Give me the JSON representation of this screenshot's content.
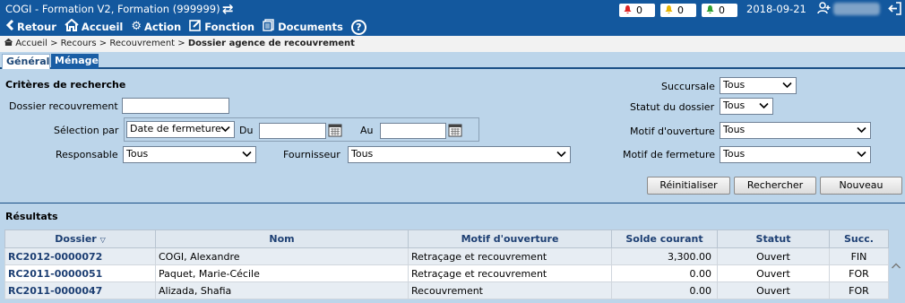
{
  "app": {
    "title": "COGI - Formation V2, Formation (999999)"
  },
  "toolbar": {
    "back_label": "Retour",
    "home_label": "Accueil",
    "action_label": "Action",
    "function_label": "Fonction",
    "documents_label": "Documents"
  },
  "alerts": {
    "red": "0",
    "yellow": "0",
    "green": "0"
  },
  "date": "2018-09-21",
  "breadcrumb": {
    "home": "Accueil",
    "recours": "Recours",
    "recouvrement": "Recouvrement",
    "current": "Dossier agence de recouvrement",
    "sep": ">"
  },
  "tabs": {
    "general": "Général",
    "menage": "Ménage"
  },
  "criteria": {
    "title": "Critères de recherche",
    "dossier_label": "Dossier recouvrement",
    "dossier_value": "",
    "selection_label": "Sélection par",
    "selection_value": "Date de fermeture",
    "du_label": "Du",
    "du_value": "",
    "au_label": "Au",
    "au_value": "",
    "responsable_label": "Responsable",
    "responsable_value": "Tous",
    "fournisseur_label": "Fournisseur",
    "fournisseur_value": "Tous",
    "succursale_label": "Succursale",
    "succursale_value": "Tous",
    "statut_label": "Statut du dossier",
    "statut_value": "Tous",
    "motif_ouv_label": "Motif d'ouverture",
    "motif_ouv_value": "Tous",
    "motif_ferm_label": "Motif de fermeture",
    "motif_ferm_value": "Tous"
  },
  "buttons": {
    "reset": "Réinitialiser",
    "search": "Rechercher",
    "new": "Nouveau"
  },
  "results": {
    "title": "Résultats",
    "columns": [
      "Dossier",
      "Nom",
      "Motif d'ouverture",
      "Solde courant",
      "Statut",
      "Succ."
    ],
    "rows": [
      [
        "RC2012-0000072",
        "COGI, Alexandre",
        "Retraçage et recouvrement",
        "3,300.00",
        "Ouvert",
        "FIN"
      ],
      [
        "RC2011-0000051",
        "Paquet, Marie-Cécile",
        "Retraçage et recouvrement",
        "0.00",
        "Ouvert",
        "FOR"
      ],
      [
        "RC2011-0000047",
        "Alizada, Shafia",
        "Recouvrement",
        "0.00",
        "Ouvert",
        "FOR"
      ]
    ]
  },
  "colors": {
    "header_bg": "#13589e",
    "body_bg": "#bcd5ea",
    "link": "#1d3f73"
  }
}
